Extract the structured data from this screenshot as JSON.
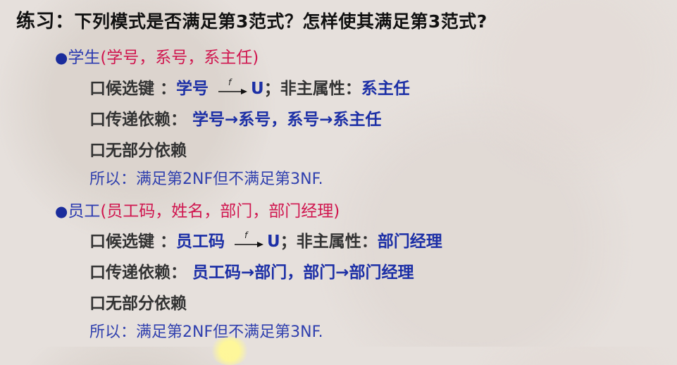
{
  "title": {
    "lead": "练习：",
    "question": "下列模式是否满足第3范式？怎样使其满足第3范式?"
  },
  "sections": [
    {
      "bullet": "●",
      "name": "学生",
      "attrs": "(学号，系号，系主任)",
      "rows": [
        {
          "box": "口",
          "label": "候选键 ：",
          "key": "学号",
          "fd_label": "f",
          "target": "U",
          "sep": "；非主属性：",
          "nonprime": "系主任"
        },
        {
          "box": "口",
          "label": "传递依赖： ",
          "chain": "学号→系号，系号→系主任"
        },
        {
          "box": "口",
          "label": "无部分依赖"
        }
      ],
      "conclusion": "所以：满足第2NF但不满足第3NF."
    },
    {
      "bullet": "●",
      "name": "员工",
      "attrs": "(员工码，姓名，部门，部门经理)",
      "rows": [
        {
          "box": "口",
          "label": "候选键 ：",
          "key": "员工码",
          "fd_label": "f",
          "target": "U",
          "sep": "；非主属性：",
          "nonprime": "部门经理"
        },
        {
          "box": "口",
          "label": "传递依赖： ",
          "chain": "员工码→部门，部门→部门经理"
        },
        {
          "box": "口",
          "label": "无部分依赖"
        }
      ],
      "conclusion": "所以：满足第2NF但不满足第3NF."
    }
  ]
}
